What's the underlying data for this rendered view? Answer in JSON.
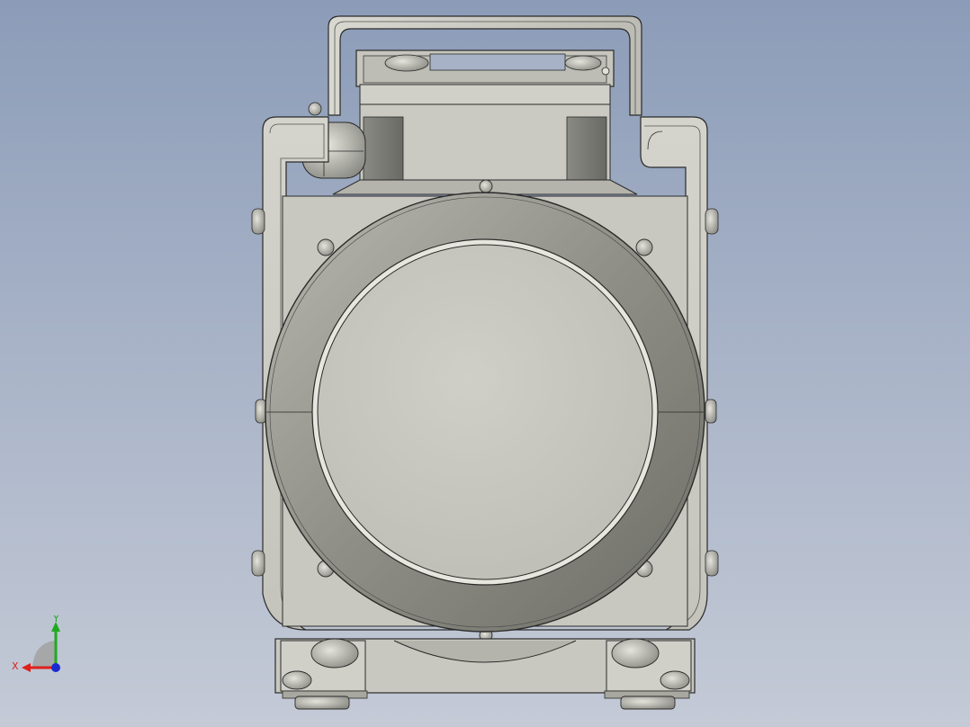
{
  "viewport": {
    "background_top": "#8c9cb8",
    "background_bottom": "#c4cad6",
    "model_fill": "#c8c8c0",
    "model_edge": "#2a2a2a"
  },
  "triad": {
    "x_label": "X",
    "y_label": "Y",
    "x_color": "#e0201c",
    "y_color": "#1faa1f",
    "z_color": "#1a2ad0"
  }
}
